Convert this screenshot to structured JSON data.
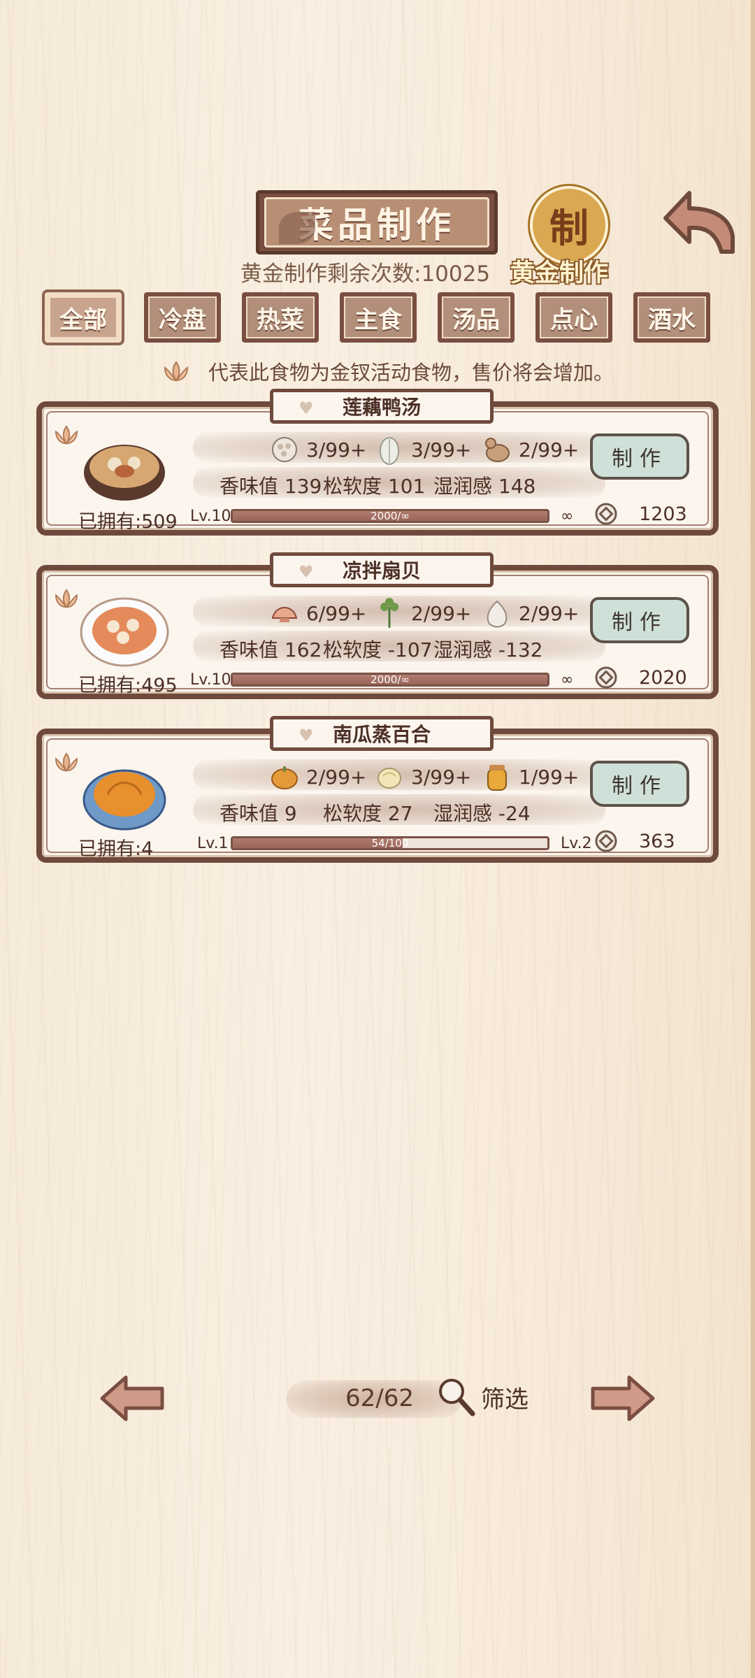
{
  "header": {
    "title": "菜品制作",
    "seal_char": "制",
    "gold_count_text": "黄金制作剩余次数:10025",
    "gold_label": "黄金制作"
  },
  "tabs": [
    "全部",
    "冷盘",
    "热菜",
    "主食",
    "汤品",
    "点心",
    "酒水"
  ],
  "active_tab": 0,
  "notice": "代表此食物为金钗活动食物，售价将会增加。",
  "dishes": [
    {
      "name": "莲藕鸭汤",
      "owned": "已拥有:509",
      "ingredients": [
        "3/99+",
        "3/99+",
        "2/99+"
      ],
      "ingredient_icons": [
        "lotus-root-icon",
        "cabbage-icon",
        "duck-icon"
      ],
      "stats": [
        "香味值 139",
        "松软度 101",
        "湿润感 148"
      ],
      "level": "Lv.10",
      "progress_text": "2000/∞",
      "progress": 1.0,
      "next_level": "∞",
      "button": "制作",
      "price": "1203"
    },
    {
      "name": "凉拌扇贝",
      "owned": "已拥有:495",
      "ingredients": [
        "6/99+",
        "2/99+",
        "2/99+"
      ],
      "ingredient_icons": [
        "scallop-icon",
        "cilantro-icon",
        "garlic-icon"
      ],
      "stats": [
        "香味值 162",
        "松软度 -107",
        "湿润感 -132"
      ],
      "level": "Lv.10",
      "progress_text": "2000/∞",
      "progress": 1.0,
      "next_level": "∞",
      "button": "制作",
      "price": "2020"
    },
    {
      "name": "南瓜蒸百合",
      "owned": "已拥有:4",
      "ingredients": [
        "2/99+",
        "3/99+",
        "1/99+"
      ],
      "ingredient_icons": [
        "pumpkin-icon",
        "lily-bulb-icon",
        "honey-jar-icon"
      ],
      "stats": [
        "香味值 9",
        "松软度 27",
        "湿润感 -24"
      ],
      "level": "Lv.1",
      "progress_text": "54/100",
      "progress": 0.54,
      "next_level": "Lv.2",
      "button": "制作",
      "price": "363"
    }
  ],
  "footer": {
    "page": "62/62",
    "filter_label": "筛选"
  },
  "colors": {
    "frame_brown": "#6f4a3c",
    "button_green": "#cfe0d9",
    "gold": "#d9a851"
  }
}
